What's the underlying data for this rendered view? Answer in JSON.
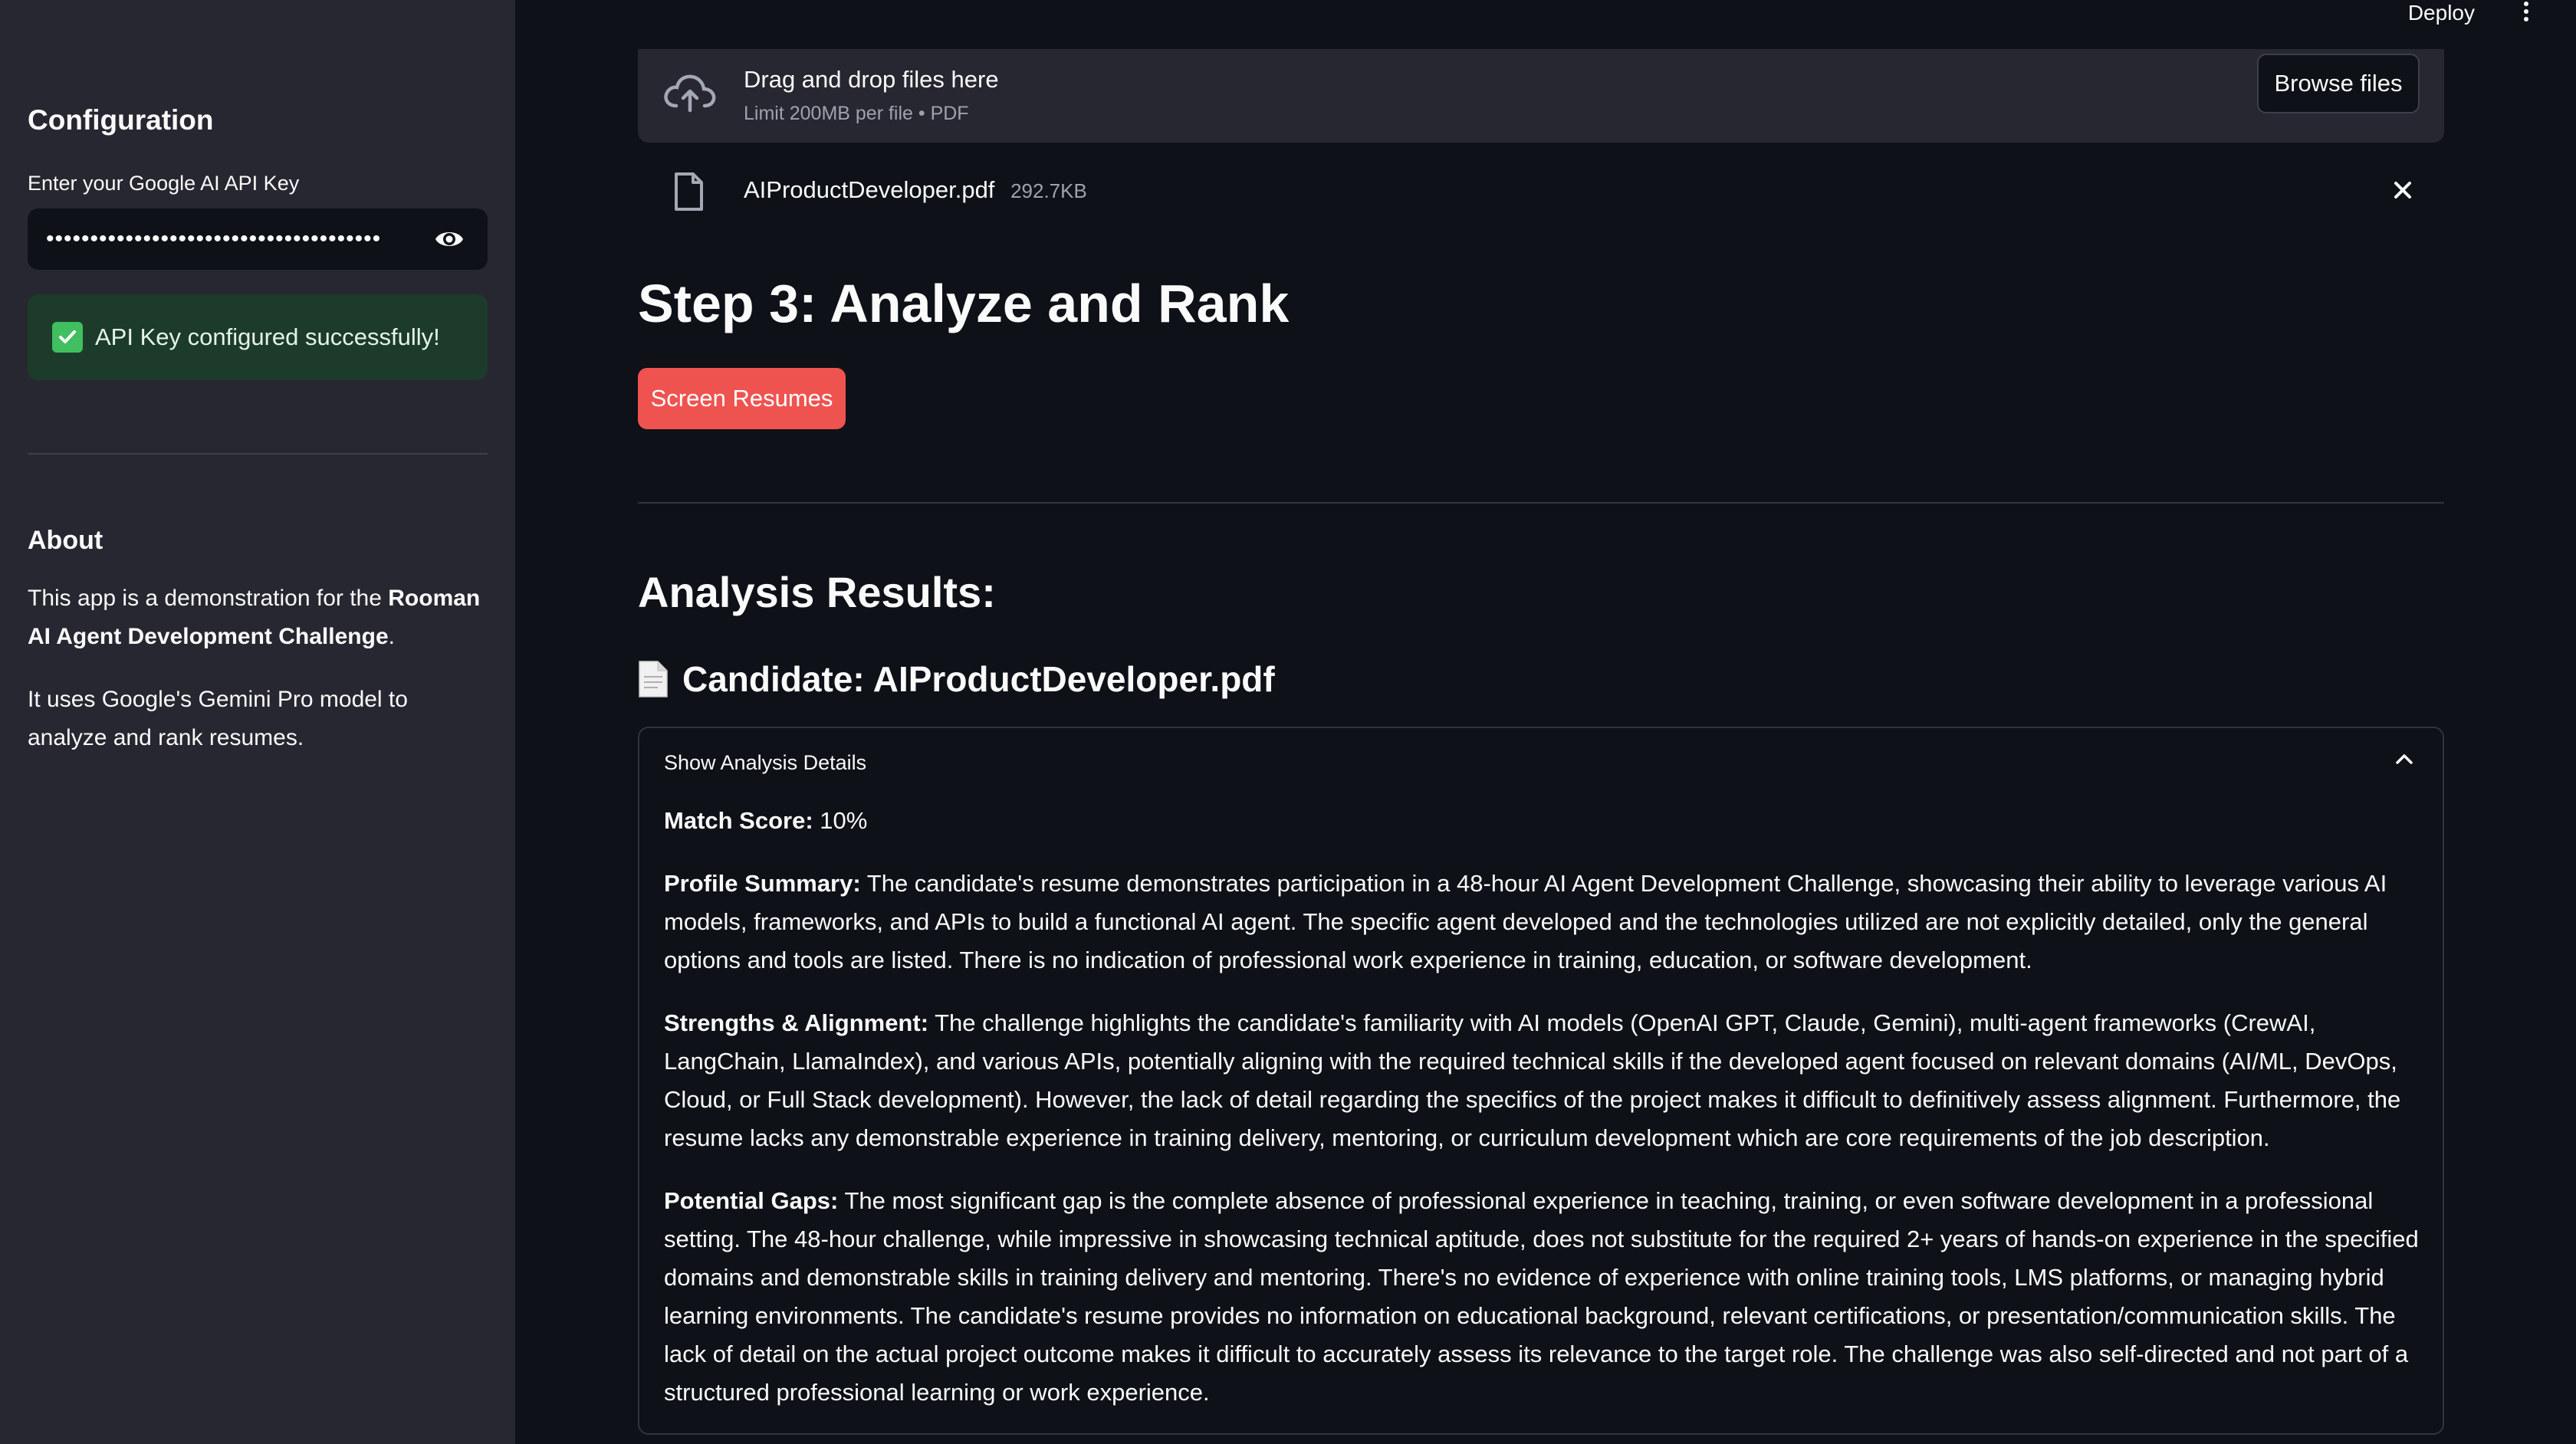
{
  "topbar": {
    "deploy_label": "Deploy",
    "menu_icon": "kebab-menu-icon"
  },
  "sidebar": {
    "heading": "Configuration",
    "api_key_label": "Enter your Google AI API Key",
    "api_key_value": "••••••••••••••••••••••••••••••••••••••",
    "visibility_icon": "eye-icon",
    "success_message": "API Key configured successfully!",
    "about_heading": "About",
    "about_p1_prefix": "This app is a demonstration for the ",
    "about_p1_bold": "Rooman AI Agent Development Challenge",
    "about_p1_suffix": ".",
    "about_p2": "It uses Google's Gemini Pro model to analyze and rank resumes."
  },
  "uploader": {
    "title": "Drag and drop files here",
    "hint": "Limit 200MB per file • PDF",
    "browse_label": "Browse files",
    "file_name": "AIProductDeveloper.pdf",
    "file_size": "292.7KB"
  },
  "step3": {
    "title": "Step 3: Analyze and Rank",
    "button_label": "Screen Resumes"
  },
  "results": {
    "title": "Analysis Results:",
    "candidate_title": "Candidate: AIProductDeveloper.pdf",
    "expander_label": "Show Analysis Details",
    "match_label": "Match Score:",
    "match_value": "10%",
    "summary_label": "Profile Summary:",
    "summary_text": "The candidate's resume demonstrates participation in a 48-hour AI Agent Development Challenge, showcasing their ability to leverage various AI models, frameworks, and APIs to build a functional AI agent. The specific agent developed and the technologies utilized are not explicitly detailed, only the general options and tools are listed. There is no indication of professional work experience in training, education, or software development.",
    "strengths_label": "Strengths & Alignment:",
    "strengths_text": "The challenge highlights the candidate's familiarity with AI models (OpenAI GPT, Claude, Gemini), multi-agent frameworks (CrewAI, LangChain, LlamaIndex), and various APIs, potentially aligning with the required technical skills if the developed agent focused on relevant domains (AI/ML, DevOps, Cloud, or Full Stack development). However, the lack of detail regarding the specifics of the project makes it difficult to definitively assess alignment. Furthermore, the resume lacks any demonstrable experience in training delivery, mentoring, or curriculum development which are core requirements of the job description.",
    "gaps_label": "Potential Gaps:",
    "gaps_text": "The most significant gap is the complete absence of professional experience in teaching, training, or even software development in a professional setting. The 48-hour challenge, while impressive in showcasing technical aptitude, does not substitute for the required 2+ years of hands-on experience in the specified domains and demonstrable skills in training delivery and mentoring. There's no evidence of experience with online training tools, LMS platforms, or managing hybrid learning environments. The candidate's resume provides no information on educational background, relevant certifications, or presentation/communication skills. The lack of detail on the actual project outcome makes it difficult to accurately assess its relevance to the target role. The challenge was also self-directed and not part of a structured professional learning or work experience."
  },
  "colors": {
    "background": "#0e1117",
    "sidebar": "#262730",
    "primary_button": "#ef5350",
    "success_bg": "#1d3b2b"
  }
}
